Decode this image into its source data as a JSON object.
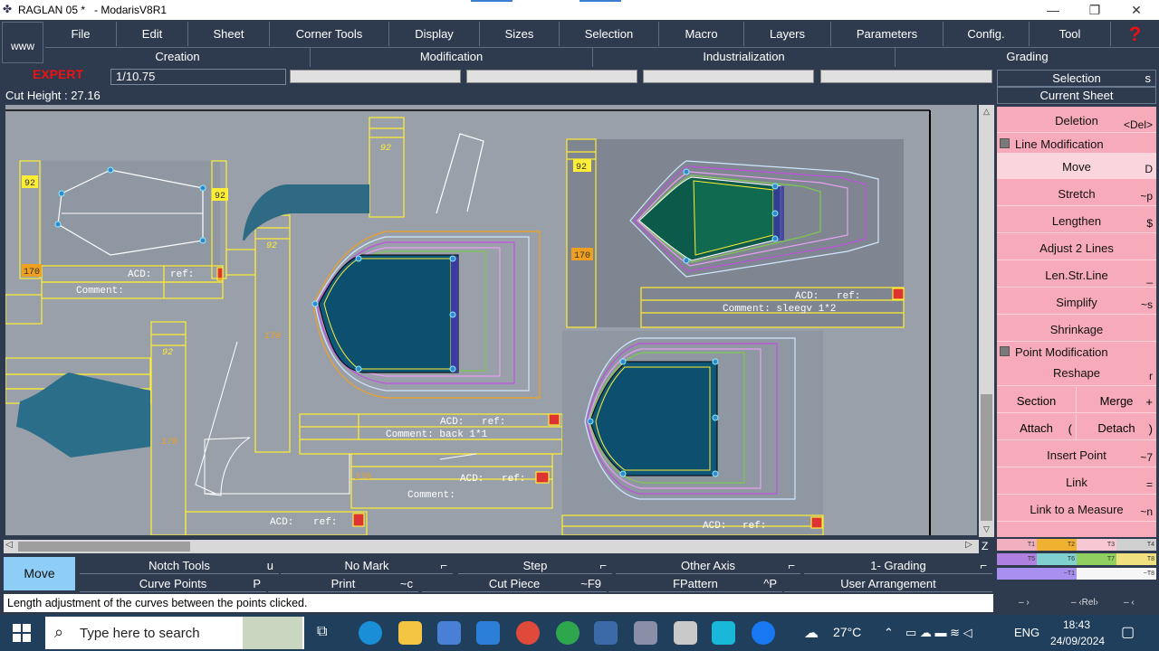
{
  "window": {
    "title": "RAGLAN 05 *   - ModarisV8R1",
    "minimize_glyph": "—",
    "restore_glyph": "❐",
    "close_glyph": "✕"
  },
  "logo": "www",
  "menu": [
    "File",
    "Edit",
    "Sheet",
    "Corner Tools",
    "Display",
    "Sizes",
    "Selection",
    "Macro",
    "Layers",
    "Parameters",
    "Config.",
    "Tool"
  ],
  "help_glyph": "?",
  "submenu": [
    "Creation",
    "Modification",
    "Industrialization",
    "Grading"
  ],
  "mode_label": "EXPERT",
  "scale_value": "1/10.75",
  "cut_height": "Cut Height : 27.16",
  "right_panel": {
    "selection": "Selection",
    "selection_key": "s",
    "current_sheet": "Current Sheet",
    "deletion": {
      "label": "Deletion",
      "key": "<Del>"
    },
    "line_mod_header": "Line Modification",
    "line_items": [
      {
        "label": "Move",
        "key": "D"
      },
      {
        "label": "Stretch",
        "key": "~p"
      },
      {
        "label": "Lengthen",
        "key": "$"
      },
      {
        "label": "Adjust 2 Lines",
        "key": ""
      },
      {
        "label": "Len.Str.Line",
        "key": "_"
      },
      {
        "label": "Simplify",
        "key": "~s"
      },
      {
        "label": "Shrinkage",
        "key": ""
      }
    ],
    "point_mod_header": "Point Modification",
    "reshape": {
      "label": "Reshape",
      "key": "r"
    },
    "section": {
      "label": "Section",
      "key": ""
    },
    "merge": {
      "label": "Merge",
      "key": "+"
    },
    "attach": {
      "label": "Attach",
      "key": "("
    },
    "detach": {
      "label": "Detach",
      "key": ")"
    },
    "point_items": [
      {
        "label": "Insert Point",
        "key": "~7"
      },
      {
        "label": "Link",
        "key": "="
      },
      {
        "label": "Link to a Measure",
        "key": "~n"
      }
    ]
  },
  "pieces": {
    "p1": {
      "size": "92",
      "size2": "170",
      "acd": "ACD:",
      "ref": "ref:",
      "comment": "Comment:"
    },
    "p2": {
      "size": "92",
      "size2": "170"
    },
    "p3": {
      "size": "92"
    },
    "p4": {
      "size": "92",
      "size2": "170"
    },
    "p5": {
      "acd": "ACD:",
      "ref": "ref:",
      "comment": "Comment:  back 1*1",
      "comment2": "Comment:",
      "size2": "170"
    },
    "p6": {
      "size": "92",
      "size2": "170",
      "acd": "ACD:",
      "ref": "ref:",
      "comment": "Comment:  sleegv 1*2"
    },
    "p7": {
      "acd": "ACD:",
      "ref": "ref:"
    }
  },
  "bottom": {
    "move": "Move",
    "row1": [
      {
        "label": "Notch Tools",
        "key": "u"
      },
      {
        "label": "No Mark",
        "key": "⌐"
      },
      {
        "label": "Step",
        "key": "⌐"
      },
      {
        "label": "Other Axis",
        "key": "⌐"
      },
      {
        "label": "1- Grading",
        "key": "⌐"
      }
    ],
    "row2": [
      {
        "label": "Curve Points",
        "key": "P"
      },
      {
        "label": "Print",
        "key": "~c"
      },
      {
        "label": "Cut Piece",
        "key": "~F9"
      },
      {
        "label": "FPattern",
        "key": "^P"
      },
      {
        "label": "User Arrangement",
        "key": ""
      }
    ],
    "help_text": "Length adjustment of the curves between the points clicked."
  },
  "colors_tags": [
    "T1",
    "T2",
    "T3",
    "T4",
    "T5",
    "T6",
    "T7",
    "T8",
    "~T1",
    "~T8"
  ],
  "nav": {
    "left": "– ›",
    "mid": "– ‹Rel›",
    "right": "– ‹"
  },
  "taskbar": {
    "search_placeholder": "Type here to search",
    "weather": "27°C",
    "lang": "ENG",
    "time": "18:43",
    "date": "24/09/2024"
  }
}
